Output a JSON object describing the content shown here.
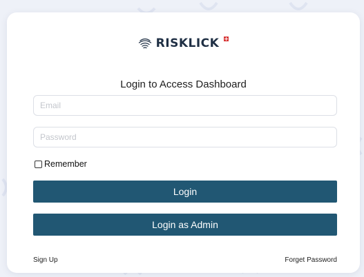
{
  "brand": {
    "name": "RISKLICK"
  },
  "login": {
    "heading": "Login to Access Dashboard",
    "email_placeholder": "Email",
    "password_placeholder": "Password",
    "remember_label": "Remember",
    "login_button": "Login",
    "admin_button": "Login as Admin",
    "signup_link": "Sign Up",
    "forget_link": "Forget Password"
  },
  "colors": {
    "button": "#215773",
    "logo_text": "#1f2f44",
    "logo_accent": "#d83a3a",
    "background": "#eef1f8"
  },
  "icons": {
    "logo": "fingerprint-logo-icon",
    "flag": "swiss-flag-icon"
  }
}
